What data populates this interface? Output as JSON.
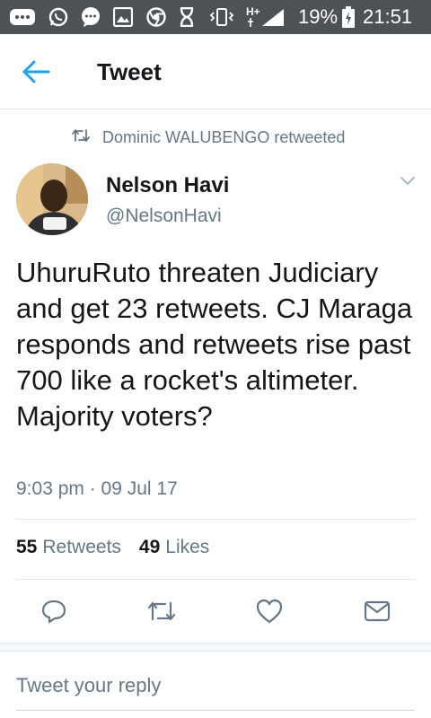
{
  "status_bar": {
    "battery": "19%",
    "time": "21:51",
    "network": "H+",
    "icons": [
      "message-icon",
      "whatsapp-icon",
      "chat-icon",
      "gallery-icon",
      "chrome-icon",
      "hourglass-icon",
      "vibrate-icon",
      "signal-icon",
      "battery-icon"
    ]
  },
  "app_bar": {
    "back_icon": "back-arrow-icon",
    "title": "Tweet"
  },
  "tweet": {
    "retweet_context": "Dominic WALUBENGO retweeted",
    "author_name": "Nelson Havi",
    "author_handle": "@NelsonHavi",
    "text": "UhuruRuto threaten Judiciary and get 23 retweets. CJ Maraga responds and retweets rise past 700 like a rocket's altimeter. Majority voters?",
    "timestamp": "9:03 pm · 09 Jul 17",
    "retweets_count": "55",
    "retweets_label": "Retweets",
    "likes_count": "49",
    "likes_label": "Likes"
  },
  "actions": [
    "reply-icon",
    "retweet-icon",
    "like-icon",
    "message-icon"
  ],
  "reply": {
    "placeholder": "Tweet your reply"
  },
  "colors": {
    "accent": "#1da1f2",
    "status_bar": "#4d5256",
    "secondary_text": "#657786"
  }
}
